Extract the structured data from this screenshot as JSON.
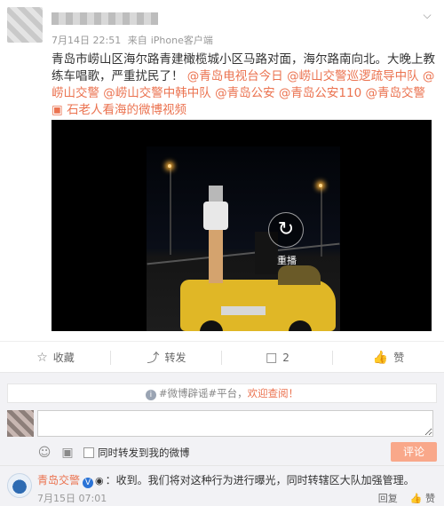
{
  "post": {
    "meta": {
      "date": "7月14日 22:51",
      "source_prefix": "来自",
      "source": "iPhone客户端"
    },
    "content": {
      "text": "青岛市崂山区海尔路青建橄榄城小区马路对面，海尔路南向北。大晚上教练车唱歌，严重扰民了！",
      "mentions": [
        "@青岛电视台今日",
        "@崂山交警巡逻疏导中队",
        "@崂山交警",
        "@崂山交警中韩中队",
        "@青岛公安",
        "@青岛公安110",
        "@青岛交警"
      ],
      "topic": "石老人看海的微博视频"
    },
    "video": {
      "replay_label": "重播"
    }
  },
  "actions": {
    "favorite": "收藏",
    "repost": "转发",
    "comment_count": "2",
    "like": "赞"
  },
  "comment_box": {
    "notice_prefix": "#微博辟谣#平台，",
    "notice_highlight": "欢迎查阅！",
    "placeholder": "",
    "also_repost": "同时转发到我的微博",
    "submit": "评论"
  },
  "reply": {
    "author": "青岛交警",
    "text": "：收到。我们将对这种行为进行曝光，同时转辖区大队加强管理。",
    "time": "7月15日 07:01",
    "reply_label": "回复",
    "like_label": "赞"
  },
  "colors": {
    "link": "#eb7350",
    "submit_bg": "#f9a88a"
  }
}
